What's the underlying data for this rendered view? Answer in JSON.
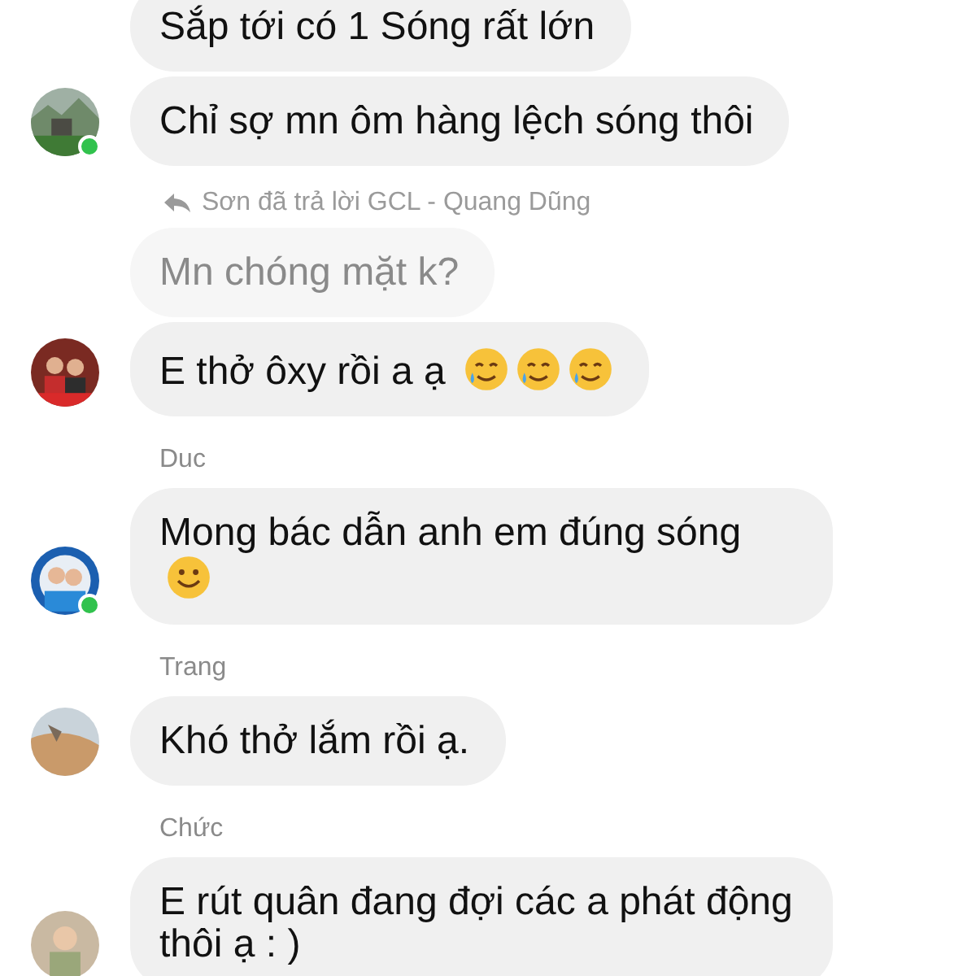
{
  "groups": [
    {
      "online": true,
      "messages": [
        {
          "kind": "normal",
          "text": "Sắp tới có 1 Sóng rất lớn"
        },
        {
          "kind": "normal",
          "text": "Chỉ sợ mn ôm hàng lệch sóng thôi"
        }
      ]
    },
    {
      "reply_note": "Sơn đã trả lời GCL - Quang Dũng",
      "online": false,
      "messages": [
        {
          "kind": "quoted",
          "text": "Mn chóng mặt k?"
        },
        {
          "kind": "normal",
          "text": "E thở ôxy rồi a ạ",
          "emojis": [
            {
              "kind": "tearful-smile"
            },
            {
              "kind": "tearful-smile"
            },
            {
              "kind": "tearful-smile"
            }
          ]
        }
      ]
    },
    {
      "sender": "Duc",
      "online": true,
      "messages": [
        {
          "kind": "normal",
          "text": "Mong bác dẫn anh em đúng sóng",
          "emojis": [
            {
              "kind": "smile"
            }
          ]
        }
      ]
    },
    {
      "sender": "Trang",
      "online": false,
      "messages": [
        {
          "kind": "normal",
          "text": "Khó thở lắm rồi ạ."
        }
      ]
    },
    {
      "sender": "Chức",
      "online": false,
      "messages": [
        {
          "kind": "normal",
          "text": "E rút quân đang đợi các a phát động thôi ạ : )"
        }
      ]
    }
  ]
}
